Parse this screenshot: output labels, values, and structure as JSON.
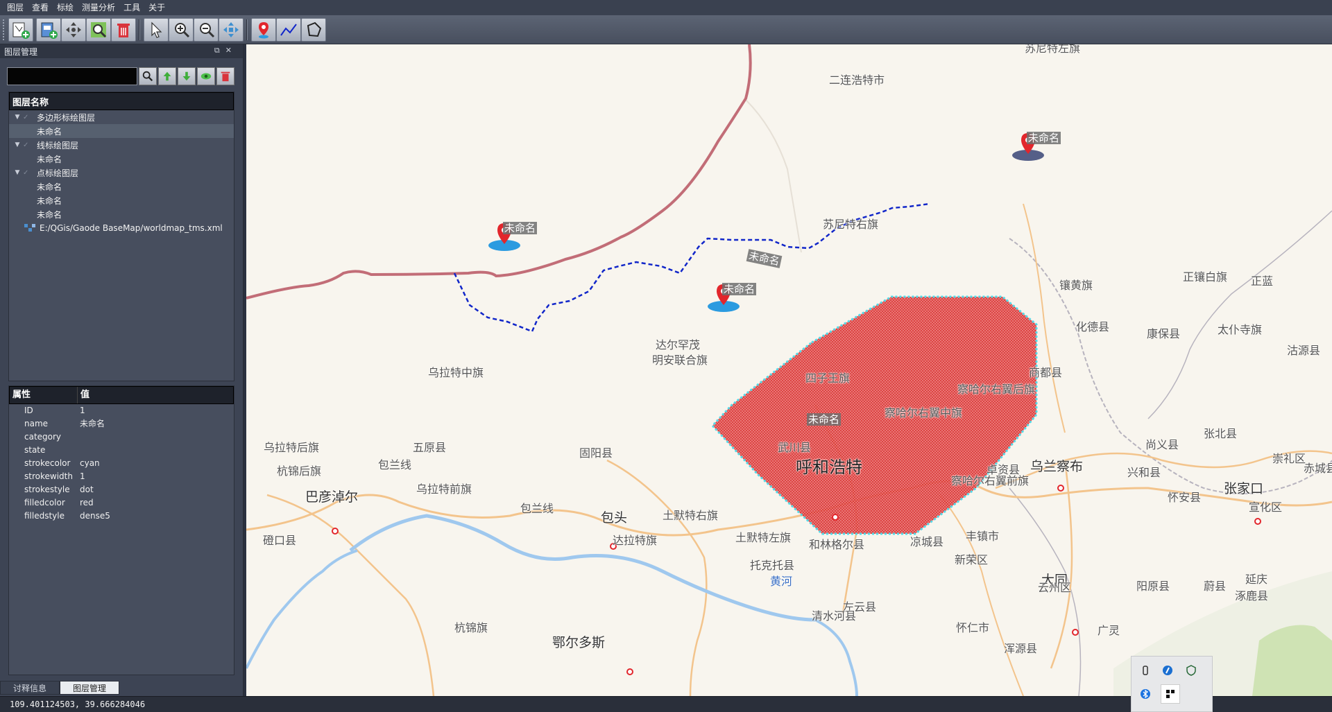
{
  "menu": [
    "图层",
    "查看",
    "标绘",
    "测量分析",
    "工具",
    "关于"
  ],
  "toolbar": {
    "buttons": [
      {
        "name": "add-vector-layer-button",
        "icon": "add-vector-icon"
      },
      {
        "name": "add-raster-layer-button",
        "icon": "add-raster-icon"
      },
      {
        "name": "pan-button",
        "icon": "pan-icon"
      },
      {
        "name": "zoom-full-button",
        "icon": "zoom-full-icon"
      },
      {
        "name": "delete-layer-button",
        "icon": "trash-icon"
      },
      {
        "name": "select-button",
        "icon": "cursor-icon"
      },
      {
        "name": "zoom-in-button",
        "icon": "zoom-in-icon"
      },
      {
        "name": "zoom-out-button",
        "icon": "zoom-out-icon"
      },
      {
        "name": "identify-button",
        "icon": "identify-icon"
      },
      {
        "name": "draw-point-button",
        "icon": "map-pin-icon"
      },
      {
        "name": "draw-line-button",
        "icon": "polyline-icon"
      },
      {
        "name": "draw-polygon-button",
        "icon": "polygon-icon"
      }
    ]
  },
  "panel": {
    "title": "图层管理",
    "search_value": "",
    "tree_header": "图层名称",
    "tree": [
      {
        "label": "多边形标绘图层",
        "level": 0,
        "expanded": true
      },
      {
        "label": "未命名",
        "level": 1,
        "selected": true
      },
      {
        "label": "线标绘图层",
        "level": 0,
        "expanded": true
      },
      {
        "label": "未命名",
        "level": 1
      },
      {
        "label": "点标绘图层",
        "level": 0,
        "expanded": true
      },
      {
        "label": "未命名",
        "level": 1
      },
      {
        "label": "未命名",
        "level": 1
      },
      {
        "label": "未命名",
        "level": 1
      },
      {
        "label": "E:/QGis/Gaode BaseMap/worldmap_tms.xml",
        "level": 0,
        "raster": true
      }
    ],
    "attr_header": {
      "key": "属性",
      "value": "值"
    },
    "attributes": [
      {
        "key": "ID",
        "value": "1"
      },
      {
        "key": "name",
        "value": "未命名"
      },
      {
        "key": "category",
        "value": ""
      },
      {
        "key": "state",
        "value": ""
      },
      {
        "key": "strokecolor",
        "value": "cyan"
      },
      {
        "key": "strokewidth",
        "value": "1"
      },
      {
        "key": "strokestyle",
        "value": "dot"
      },
      {
        "key": "filledcolor",
        "value": "red"
      },
      {
        "key": "filledstyle",
        "value": "dense5"
      }
    ],
    "tabs": [
      "讨释信息",
      "图层管理"
    ]
  },
  "status": {
    "coords": "109.401124503, 39.666284046"
  },
  "map": {
    "places": [
      {
        "name": "二连浩特市",
        "cls": ""
      },
      {
        "name": "苏尼特左旗",
        "cls": ""
      },
      {
        "name": "苏尼特右旗",
        "cls": ""
      },
      {
        "name": "镶黄旗",
        "cls": ""
      },
      {
        "name": "正镶白旗",
        "cls": ""
      },
      {
        "name": "正蓝",
        "cls": ""
      },
      {
        "name": "化德县",
        "cls": ""
      },
      {
        "name": "康保县",
        "cls": ""
      },
      {
        "name": "太仆寺旗",
        "cls": ""
      },
      {
        "name": "沽源县",
        "cls": ""
      },
      {
        "name": "商都县",
        "cls": ""
      },
      {
        "name": "察哈尔右翼后旗",
        "cls": ""
      },
      {
        "name": "察哈尔右翼中旗",
        "cls": ""
      },
      {
        "name": "达尔罕茂",
        "cls": ""
      },
      {
        "name": "明安联合旗",
        "cls": ""
      },
      {
        "name": "四子王旗",
        "cls": ""
      },
      {
        "name": "乌拉特中旗",
        "cls": ""
      },
      {
        "name": "乌拉特后旗",
        "cls": ""
      },
      {
        "name": "五原县",
        "cls": ""
      },
      {
        "name": "固阳县",
        "cls": ""
      },
      {
        "name": "武川县",
        "cls": ""
      },
      {
        "name": "呼和浩特",
        "cls": "big"
      },
      {
        "name": "卓资县",
        "cls": ""
      },
      {
        "name": "乌兰察布",
        "cls": "mid"
      },
      {
        "name": "兴和县",
        "cls": ""
      },
      {
        "name": "尚义县",
        "cls": ""
      },
      {
        "name": "张北县",
        "cls": ""
      },
      {
        "name": "崇礼区",
        "cls": ""
      },
      {
        "name": "赤城县",
        "cls": ""
      },
      {
        "name": "张家口",
        "cls": "mid"
      },
      {
        "name": "宣化区",
        "cls": ""
      },
      {
        "name": "察哈尔右翼前旗",
        "cls": ""
      },
      {
        "name": "怀安县",
        "cls": ""
      },
      {
        "name": "杭锦后旗",
        "cls": ""
      },
      {
        "name": "巴彦淖尔",
        "cls": "mid"
      },
      {
        "name": "乌拉特前旗",
        "cls": ""
      },
      {
        "name": "包兰线",
        "cls": ""
      },
      {
        "name": "包兰线",
        "cls": ""
      },
      {
        "name": "包头",
        "cls": "mid"
      },
      {
        "name": "土默特右旗",
        "cls": ""
      },
      {
        "name": "土默特左旗",
        "cls": ""
      },
      {
        "name": "达拉特旗",
        "cls": ""
      },
      {
        "name": "托克托县",
        "cls": ""
      },
      {
        "name": "黄河",
        "cls": "blue"
      },
      {
        "name": "和林格尔县",
        "cls": ""
      },
      {
        "name": "凉城县",
        "cls": ""
      },
      {
        "name": "丰镇市",
        "cls": ""
      },
      {
        "name": "新荣区",
        "cls": ""
      },
      {
        "name": "大同",
        "cls": "mid"
      },
      {
        "name": "云州区",
        "cls": ""
      },
      {
        "name": "阳原县",
        "cls": ""
      },
      {
        "name": "蔚县",
        "cls": ""
      },
      {
        "name": "涿鹿县",
        "cls": ""
      },
      {
        "name": "延庆",
        "cls": ""
      },
      {
        "name": "左云县",
        "cls": ""
      },
      {
        "name": "清水河县",
        "cls": ""
      },
      {
        "name": "磴口县",
        "cls": ""
      },
      {
        "name": "杭锦旗",
        "cls": ""
      },
      {
        "name": "鄂尔多斯",
        "cls": "mid"
      },
      {
        "name": "怀仁市",
        "cls": ""
      },
      {
        "name": "浑源县",
        "cls": ""
      },
      {
        "name": "广灵",
        "cls": ""
      }
    ],
    "features": {
      "line_label": "未命名",
      "polygon_label": "未命名",
      "points": [
        {
          "label": "未命名",
          "shadow": "#2b9be0"
        },
        {
          "label": "未命名",
          "shadow": "#2b9be0"
        },
        {
          "label": "未命名",
          "shadow": "#555f88"
        }
      ]
    },
    "colors": {
      "border": "#c26d77",
      "line": "#1126c9",
      "polygon_fill": "#e23c3c",
      "polygon_stroke": "#3fd8e8",
      "pin": "#e2262c"
    }
  }
}
